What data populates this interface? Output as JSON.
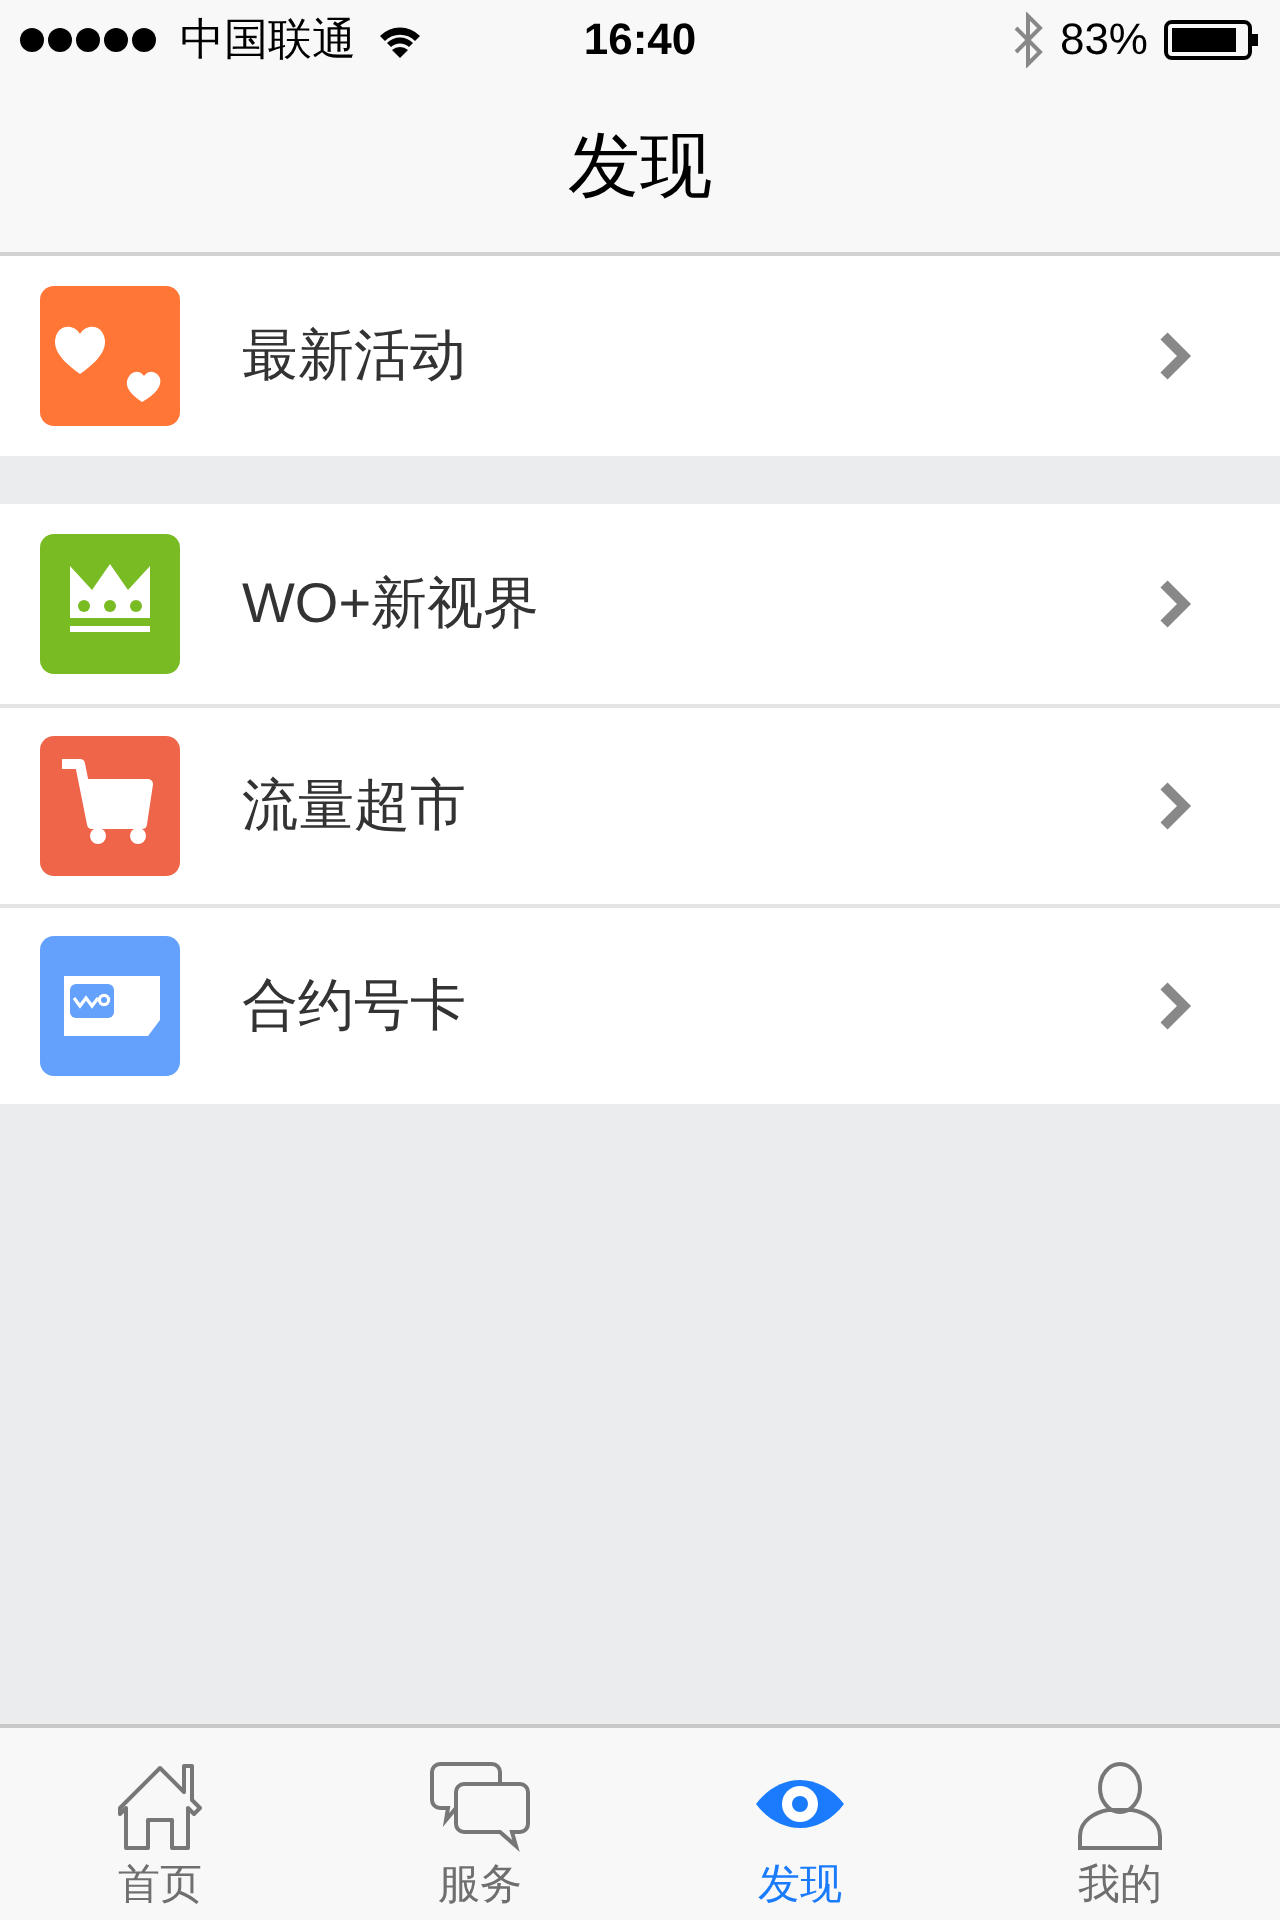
{
  "status_bar": {
    "carrier": "中国联通",
    "time": "16:40",
    "battery": "83%"
  },
  "nav_bar": {
    "title": "发现"
  },
  "groups": [
    {
      "items": [
        {
          "kind": "hearts",
          "label": "最新活动",
          "color": "#ff7637"
        }
      ]
    },
    {
      "items": [
        {
          "kind": "crown",
          "label": "WO+新视界",
          "color": "#79bb22"
        },
        {
          "kind": "cart",
          "label": "流量超市",
          "color": "#ee654a"
        },
        {
          "kind": "card",
          "label": "合约号卡",
          "color": "#64a1fd"
        }
      ]
    }
  ],
  "tab_bar": [
    {
      "kind": "home",
      "label": "首页",
      "selected": false
    },
    {
      "kind": "chat",
      "label": "服务",
      "selected": false
    },
    {
      "kind": "eye",
      "label": "发现",
      "selected": true
    },
    {
      "kind": "person",
      "label": "我的",
      "selected": false
    }
  ]
}
